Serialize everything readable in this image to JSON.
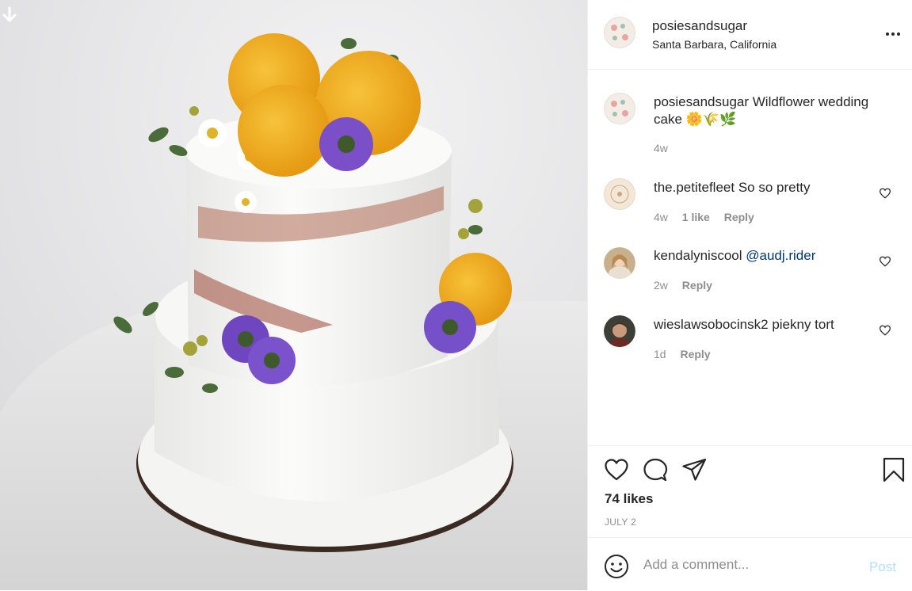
{
  "header": {
    "username": "posiesandsugar",
    "location": "Santa Barbara, California"
  },
  "caption": {
    "username": "posiesandsugar",
    "text": "Wildflower wedding cake 🌼🌾🌿",
    "time": "4w"
  },
  "comments": [
    {
      "username": "the.petitefleet",
      "text": "So so pretty",
      "time": "4w",
      "likes": "1 like",
      "reply": "Reply"
    },
    {
      "username": "kendalyniscool",
      "text": "@audj.rider",
      "time": "2w",
      "reply": "Reply"
    },
    {
      "username": "wieslawsobocinsk2",
      "text": "piekny tort",
      "time": "1d",
      "reply": "Reply"
    }
  ],
  "actions": {
    "likes": "74 likes",
    "date": "JULY 2"
  },
  "add_comment": {
    "placeholder": "Add a comment...",
    "post_label": "Post"
  },
  "colors": {
    "text": "#262626",
    "secondary": "#8e8e8e",
    "link": "#00376b",
    "post_disabled": "#b2dffc"
  }
}
